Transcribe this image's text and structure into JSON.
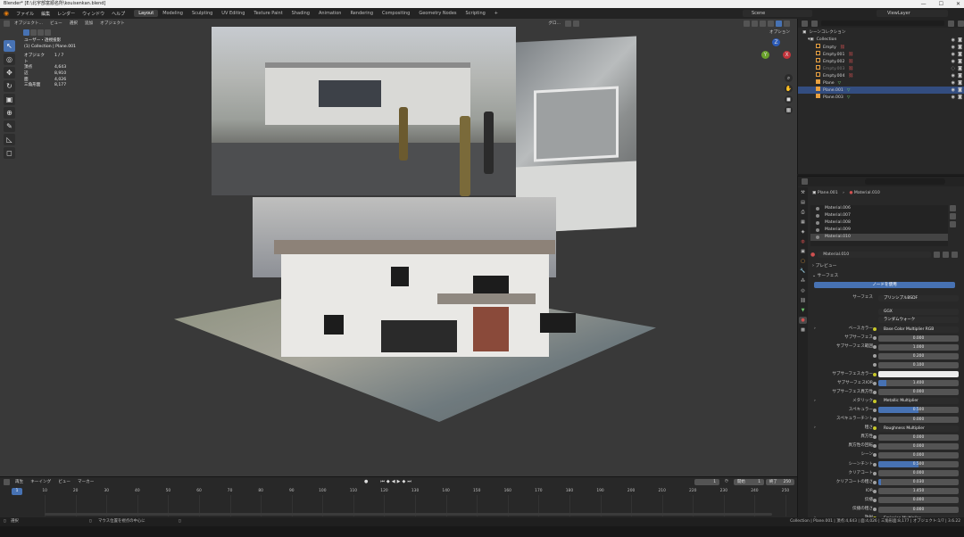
{
  "titlebar": {
    "title": "Blender* [E:\\北宇部富順名所\\kouisenkan.blend]",
    "min": "—",
    "max": "☐",
    "close": "✕"
  },
  "menu": [
    "ファイル",
    "編集",
    "レンダー",
    "ウィンドウ",
    "ヘルプ"
  ],
  "workspaces": [
    "Layout",
    "Modeling",
    "Sculpting",
    "UV Editing",
    "Texture Paint",
    "Shading",
    "Animation",
    "Rendering",
    "Compositing",
    "Geometry Nodes",
    "Scripting"
  ],
  "active_workspace": "Layout",
  "scene": "Scene",
  "view_layer": "ViewLayer",
  "viewport": {
    "mode": "オブジェクト...",
    "menus": [
      "ビュー",
      "選択",
      "追加",
      "オブジェクト"
    ],
    "shading_menu": "グロ...",
    "options": "オプション",
    "info": {
      "line1": "ユーザー・透視投影",
      "line2": "(1) Collection | Plane.001",
      "stats": [
        {
          "k": "オブジェクト",
          "v": "1 / 7"
        },
        {
          "k": "頂点",
          "v": "4,643"
        },
        {
          "k": "辺",
          "v": "8,910"
        },
        {
          "k": "面",
          "v": "4,026"
        },
        {
          "k": "三角形面",
          "v": "8,177"
        }
      ]
    }
  },
  "outliner": {
    "root": "シーンコレクション",
    "collection": "Collection",
    "items": [
      {
        "name": "Empty",
        "type": "empty",
        "selected": false,
        "dim": false
      },
      {
        "name": "Empty.001",
        "type": "empty",
        "selected": false,
        "dim": false
      },
      {
        "name": "Empty.002",
        "type": "empty",
        "selected": false,
        "dim": false
      },
      {
        "name": "Empty.003",
        "type": "empty",
        "selected": false,
        "dim": true
      },
      {
        "name": "Empty.004",
        "type": "empty",
        "selected": false,
        "dim": false
      },
      {
        "name": "Plane",
        "type": "mesh",
        "selected": false,
        "dim": false
      },
      {
        "name": "Plane.001",
        "type": "mesh",
        "selected": true,
        "dim": false
      },
      {
        "name": "Plane.003",
        "type": "mesh",
        "selected": false,
        "dim": false
      }
    ]
  },
  "properties": {
    "breadcrumb_obj": "Plane.001",
    "breadcrumb_mat": "Material.010",
    "materials": [
      "Material.006",
      "Material.007",
      "Material.008",
      "Material.009",
      "Material.010"
    ],
    "active_material": "Material.010",
    "material_field": "Material.010",
    "preview": "プレビュー",
    "surface_section": "サーフェス",
    "use_nodes": "ノードを使用",
    "surface_label": "サーフェス",
    "surface_value": "プリンシプルBSDF",
    "distribution": "GGX",
    "sss_method": "ランダムウォーク",
    "rows": [
      {
        "label": "ベースカラー",
        "value": "Base Color Multiplier RGB",
        "kind": "link",
        "fill": 0
      },
      {
        "label": "サブサーフェス",
        "value": "0.000",
        "kind": "num",
        "fill": 0
      },
      {
        "label": "サブサーフェス範囲",
        "value": "1.000",
        "kind": "num",
        "fill": 0
      },
      {
        "label": "",
        "value": "0.200",
        "kind": "num",
        "fill": 0
      },
      {
        "label": "",
        "value": "0.100",
        "kind": "num",
        "fill": 0
      },
      {
        "label": "サブサーフェスカラー",
        "value": "",
        "kind": "color",
        "fill": 0
      },
      {
        "label": "サブサーフェスIOR",
        "value": "1.400",
        "kind": "num",
        "fill": 0.1
      },
      {
        "label": "サブサーフェス異方性",
        "value": "0.000",
        "kind": "num",
        "fill": 0
      },
      {
        "label": "メタリック",
        "value": "Metallic Multiplier",
        "kind": "link",
        "fill": 0
      },
      {
        "label": "スペキュラー",
        "value": "0.500",
        "kind": "num",
        "fill": 0.5
      },
      {
        "label": "スペキュラーチント",
        "value": "0.000",
        "kind": "num",
        "fill": 0
      },
      {
        "label": "粗さ",
        "value": "Roughness Multiplier",
        "kind": "link",
        "fill": 0
      },
      {
        "label": "異方性",
        "value": "0.000",
        "kind": "num",
        "fill": 0
      },
      {
        "label": "異方性の回転",
        "value": "0.000",
        "kind": "num",
        "fill": 0
      },
      {
        "label": "シーン",
        "value": "0.000",
        "kind": "num",
        "fill": 0
      },
      {
        "label": "シーンチント",
        "value": "0.500",
        "kind": "num",
        "fill": 0.5
      },
      {
        "label": "クリアコート",
        "value": "0.000",
        "kind": "num",
        "fill": 0
      },
      {
        "label": "クリアコートの粗さ",
        "value": "0.030",
        "kind": "num",
        "fill": 0.03
      },
      {
        "label": "IOR",
        "value": "1.450",
        "kind": "num",
        "fill": 0
      },
      {
        "label": "伝播",
        "value": "0.000",
        "kind": "num",
        "fill": 0
      },
      {
        "label": "伝播の粗さ",
        "value": "0.000",
        "kind": "num",
        "fill": 0
      },
      {
        "label": "放射",
        "value": "Emission Multiplier",
        "kind": "link",
        "fill": 0
      }
    ]
  },
  "timeline": {
    "menus": [
      "再生",
      "キーイング",
      "ビュー",
      "マーカー"
    ],
    "current_frame": "1",
    "start_label": "開始",
    "start": "1",
    "end_label": "終了",
    "end": "250",
    "ticks": [
      "10",
      "20",
      "30",
      "40",
      "50",
      "60",
      "70",
      "80",
      "90",
      "100",
      "110",
      "120",
      "130",
      "140",
      "150",
      "160",
      "170",
      "180",
      "190",
      "200",
      "210",
      "220",
      "230",
      "240",
      "250"
    ]
  },
  "statusbar": {
    "left": "選択",
    "center": "マウス位置を視点の中心に",
    "right": "Collection | Plane.001 | 頂点:4,643 | 面:4,026 | 三角形面:8,177 | オブジェクト:1/7 | 3.6.22"
  },
  "colors": {
    "accent": "#4772b3",
    "selected_row": "#334d80",
    "bg_panel": "#282828",
    "bg_viewport": "#393939"
  }
}
